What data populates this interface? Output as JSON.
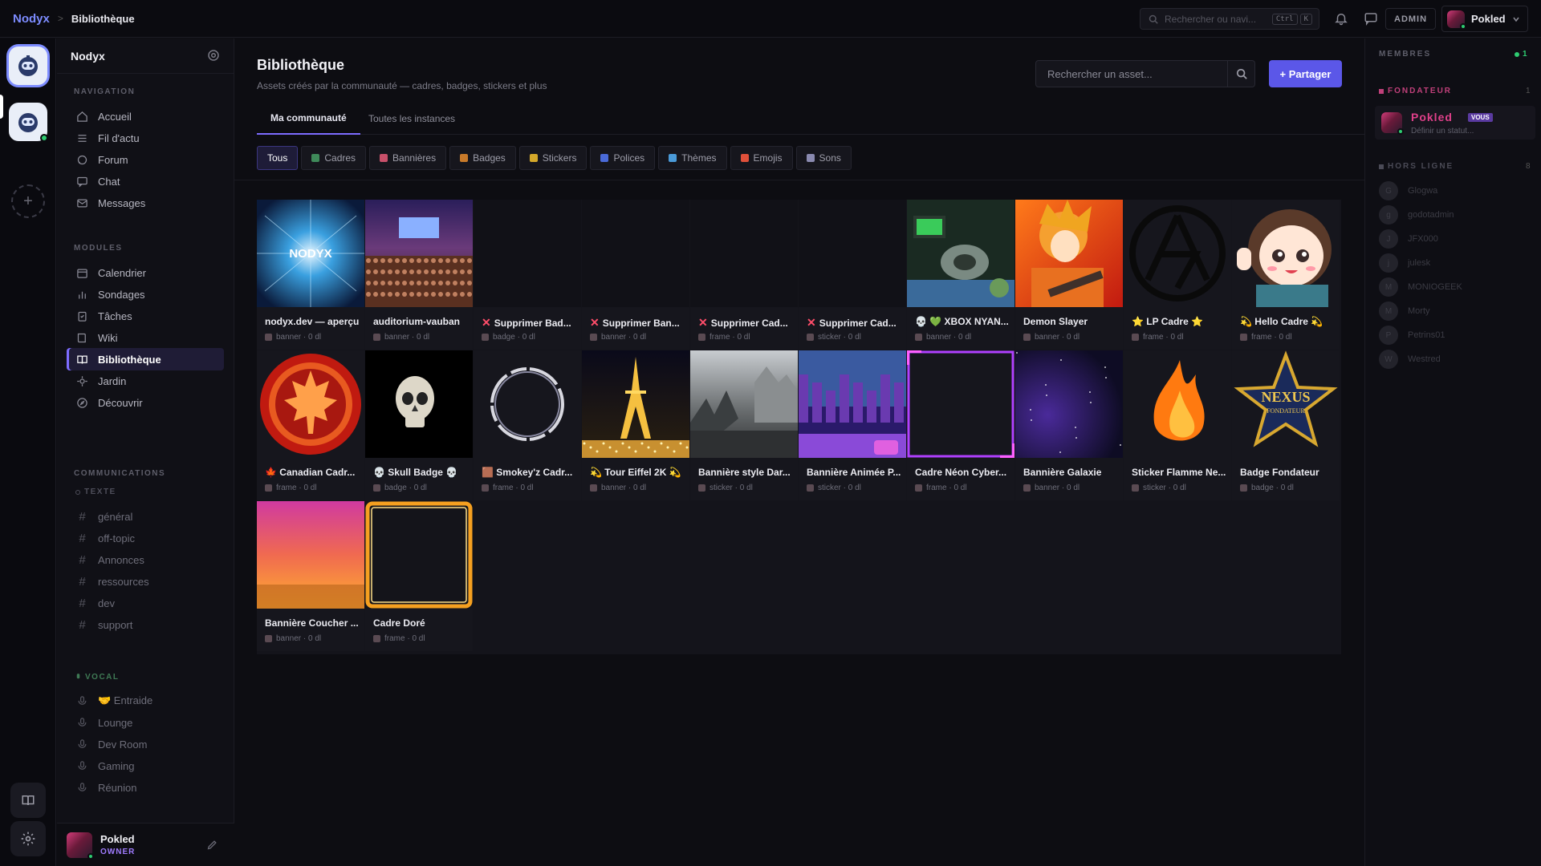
{
  "breadcrumb": {
    "brand": "Nodyx",
    "separator": ">",
    "current": "Bibliothèque"
  },
  "topbar": {
    "search_placeholder": "Rechercher ou navi...",
    "kbd_ctrl": "Ctrl",
    "kbd_k": "K",
    "admin_label": "ADMIN",
    "user_name": "Pokled"
  },
  "sidebar": {
    "server_name": "Nodyx",
    "nav_title": "NAVIGATION",
    "nav": [
      {
        "label": "Accueil",
        "icon": "home-icon"
      },
      {
        "label": "Fil d'actu",
        "icon": "feed-icon"
      },
      {
        "label": "Forum",
        "icon": "forum-icon"
      },
      {
        "label": "Chat",
        "icon": "chat-icon"
      },
      {
        "label": "Messages",
        "icon": "mail-icon"
      }
    ],
    "modules_title": "MODULES",
    "modules": [
      {
        "label": "Calendrier",
        "icon": "calendar-icon"
      },
      {
        "label": "Sondages",
        "icon": "poll-icon"
      },
      {
        "label": "Tâches",
        "icon": "tasks-icon"
      },
      {
        "label": "Wiki",
        "icon": "wiki-icon"
      },
      {
        "label": "Bibliothèque",
        "icon": "library-icon",
        "active": true
      },
      {
        "label": "Jardin",
        "icon": "garden-icon"
      },
      {
        "label": "Découvrir",
        "icon": "discover-icon"
      }
    ],
    "comms_title": "COMMUNICATIONS",
    "text_title": "TEXTE",
    "text_channels": [
      "général",
      "off-topic",
      "Annonces",
      "ressources",
      "dev",
      "support"
    ],
    "voice_title": "VOCAL",
    "voice_channels": [
      "🤝 Entraide",
      "Lounge",
      "Dev Room",
      "Gaming",
      "Réunion"
    ],
    "footer": {
      "name": "Pokled",
      "role": "OWNER"
    }
  },
  "main": {
    "title": "Bibliothèque",
    "subtitle": "Assets créés par la communauté — cadres, badges, stickers et plus",
    "search_placeholder": "Rechercher un asset...",
    "share_label": "+ Partager",
    "tabs": [
      "Ma communauté",
      "Toutes les instances"
    ],
    "filters": [
      {
        "label": "Tous",
        "color": ""
      },
      {
        "label": "Cadres",
        "color": "#3f8a5a"
      },
      {
        "label": "Bannières",
        "color": "#c8506a"
      },
      {
        "label": "Badges",
        "color": "#c87a2a"
      },
      {
        "label": "Stickers",
        "color": "#d4a82a"
      },
      {
        "label": "Polices",
        "color": "#4a6ad8"
      },
      {
        "label": "Thèmes",
        "color": "#4a9ad8"
      },
      {
        "label": "Emojis",
        "color": "#e0503a"
      },
      {
        "label": "Sons",
        "color": "#8a8ab0"
      }
    ]
  },
  "assets": [
    {
      "name": "nodyx.dev — aperçu",
      "meta": "banner · 0 dl",
      "thumb": "nodyx"
    },
    {
      "name": "auditorium-vauban",
      "meta": "banner · 0 dl",
      "thumb": "auditorium"
    },
    {
      "name": "Supprimer Bad...",
      "meta": "badge · 0 dl",
      "thumb": "empty",
      "prefix": "✕"
    },
    {
      "name": "Supprimer Ban...",
      "meta": "banner · 0 dl",
      "thumb": "empty",
      "prefix": "✕"
    },
    {
      "name": "Supprimer Cad...",
      "meta": "frame · 0 dl",
      "thumb": "empty",
      "prefix": "✕"
    },
    {
      "name": "Supprimer Cad...",
      "meta": "sticker · 0 dl",
      "thumb": "empty",
      "prefix": "✕"
    },
    {
      "name": "💀 💚 XBOX NYAN...",
      "meta": "banner · 0 dl",
      "thumb": "xbox"
    },
    {
      "name": "Demon Slayer",
      "meta": "banner · 0 dl",
      "thumb": "demon"
    },
    {
      "name": "⭐ LP Cadre ⭐",
      "meta": "frame · 0 dl",
      "thumb": "lp"
    },
    {
      "name": "💫 Hello Cadre 💫",
      "meta": "frame · 0 dl",
      "thumb": "hello"
    },
    {
      "name": "🍁 Canadian Cadr...",
      "meta": "frame · 0 dl",
      "thumb": "maple"
    },
    {
      "name": "💀 Skull Badge 💀",
      "meta": "badge · 0 dl",
      "thumb": "skull"
    },
    {
      "name": "🟫 Smokey'z Cadr...",
      "meta": "frame · 0 dl",
      "thumb": "smokey"
    },
    {
      "name": "💫 Tour Eiffel 2K 💫",
      "meta": "banner · 0 dl",
      "thumb": "eiffel"
    },
    {
      "name": "Bannière style Dar...",
      "meta": "sticker · 0 dl",
      "thumb": "dark"
    },
    {
      "name": "Bannière Animée P...",
      "meta": "sticker · 0 dl",
      "thumb": "pixel"
    },
    {
      "name": "Cadre Néon Cyber...",
      "meta": "frame · 0 dl",
      "thumb": "neon"
    },
    {
      "name": "Bannière Galaxie",
      "meta": "banner · 0 dl",
      "thumb": "galaxy"
    },
    {
      "name": "Sticker Flamme Ne...",
      "meta": "sticker · 0 dl",
      "thumb": "flame"
    },
    {
      "name": "Badge Fondateur",
      "meta": "badge · 0 dl",
      "thumb": "nexus"
    },
    {
      "name": "Bannière Coucher ...",
      "meta": "banner · 0 dl",
      "thumb": "sunset"
    },
    {
      "name": "Cadre Doré",
      "meta": "frame · 0 dl",
      "thumb": "gold"
    }
  ],
  "thumb_text": {
    "nodyx": "NODYX",
    "nexus": "NEXUS",
    "nexus_sub": "FONDATEUR"
  },
  "members": {
    "title": "MEMBRES",
    "online_count": "1",
    "founder_title": "FONDATEUR",
    "founder_count": "1",
    "founder": {
      "name": "Pokled",
      "tag": "VOUS",
      "status": "Définir un statut..."
    },
    "offline_title": "HORS LIGNE",
    "offline_count": "8",
    "offline": [
      "Glogwa",
      "godotadmin",
      "JFX000",
      "julesk",
      "MONIOGEEK",
      "Morty",
      "Petrins01",
      "Westred"
    ]
  }
}
